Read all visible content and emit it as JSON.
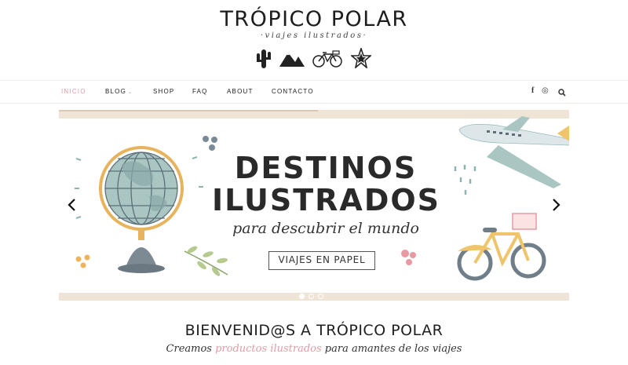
{
  "brand": {
    "title": "TRÓPICO POLAR",
    "tagline": "·viajes ilustrados·",
    "icons": [
      "cactus-icon",
      "mountains-icon",
      "bicycle-icon",
      "star-icon"
    ]
  },
  "nav": {
    "items": [
      {
        "label": "INICIO",
        "active": true
      },
      {
        "label": "BLOG",
        "has_dropdown": true
      },
      {
        "label": "SHOP"
      },
      {
        "label": "FAQ"
      },
      {
        "label": "ABOUT"
      },
      {
        "label": "CONTACTO"
      }
    ],
    "right_icons": [
      "facebook-icon",
      "instagram-icon",
      "search-icon"
    ],
    "facebook_glyph": "f",
    "instagram_glyph": "◎"
  },
  "slider": {
    "heading_line1": "DESTINOS",
    "heading_line2": "ILUSTRADOS",
    "subtitle": "para descubrir el mundo",
    "button_label": "VIAJES EN PAPEL",
    "dots": 3,
    "active_dot": 0
  },
  "welcome": {
    "title": "BIENVENID@S A TRÓPICO POLAR",
    "subtitle_before": "Creamos ",
    "subtitle_highlight": "productos ilustrados",
    "subtitle_after": " para amantes de los viajes"
  },
  "colors": {
    "accent_pink": "#e89aa3",
    "beige_band": "#efe4d5",
    "globe_teal": "#9fbfbc",
    "globe_stand": "#e7b35c",
    "bike_yellow": "#f0c46a"
  }
}
